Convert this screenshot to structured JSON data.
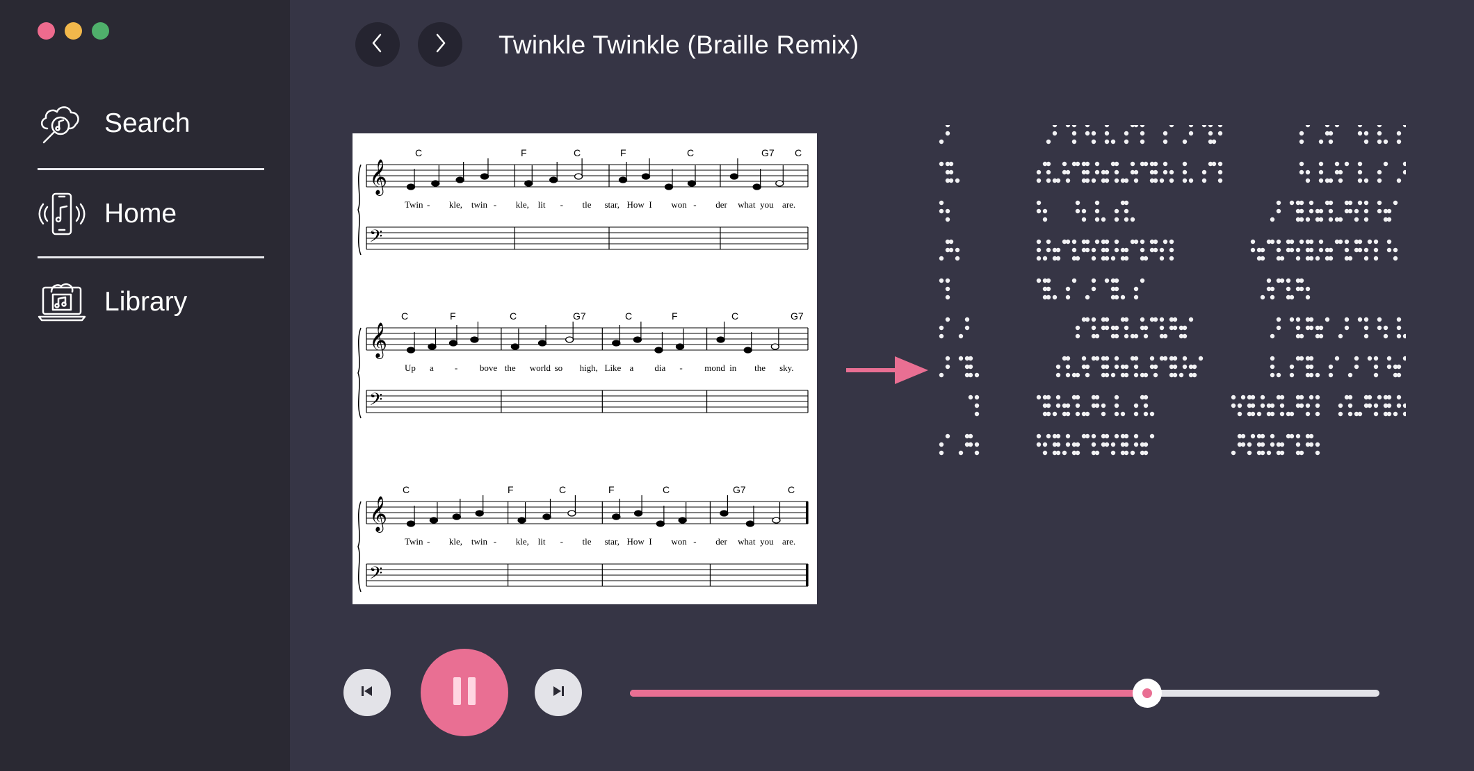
{
  "window": {
    "traffic_lights": [
      {
        "name": "close",
        "color": "#ee6b8e"
      },
      {
        "name": "minimize",
        "color": "#f2b84b"
      },
      {
        "name": "maximize",
        "color": "#4fb06b"
      }
    ]
  },
  "sidebar": {
    "items": [
      {
        "label": "Search",
        "icon": "search-music-icon"
      },
      {
        "label": "Home",
        "icon": "phone-music-icon"
      },
      {
        "label": "Library",
        "icon": "laptop-music-icon"
      }
    ]
  },
  "header": {
    "back_icon": "chevron-left-icon",
    "forward_icon": "chevron-right-icon",
    "title": "Twinkle Twinkle (Braille Remix)"
  },
  "sheet_music": {
    "systems": [
      {
        "chords": [
          "C",
          "F",
          "C",
          "F",
          "C",
          "G7",
          "C"
        ],
        "lyrics": [
          "Twin",
          "-",
          "kle,",
          "twin",
          "-",
          "kle,",
          "lit",
          "-",
          "tle",
          "star,",
          "How",
          "I",
          "won",
          "-",
          "der",
          "what",
          "you",
          "are."
        ]
      },
      {
        "chords": [
          "C",
          "F",
          "C",
          "G7",
          "C",
          "F",
          "C",
          "G7"
        ],
        "lyrics": [
          "Up",
          "a",
          "-",
          "bove",
          "the",
          "world",
          "so",
          "high,",
          "Like",
          "a",
          "dia",
          "-",
          "mond",
          "in",
          "the",
          "sky."
        ]
      },
      {
        "chords": [
          "C",
          "F",
          "C",
          "F",
          "C",
          "G7",
          "C"
        ],
        "lyrics": [
          "Twin",
          "-",
          "kle,",
          "twin",
          "-",
          "kle,",
          "lit",
          "-",
          "tle",
          "star,",
          "How",
          "I",
          "won",
          "-",
          "der",
          "what",
          "you",
          "are."
        ]
      }
    ]
  },
  "conversion_arrow": {
    "icon": "arrow-right-icon",
    "color": "#e96f93"
  },
  "player": {
    "prev_icon": "skip-back-icon",
    "play_pause_icon": "pause-icon",
    "next_icon": "skip-forward-icon",
    "progress": 0.69,
    "accent": "#e96f93"
  }
}
